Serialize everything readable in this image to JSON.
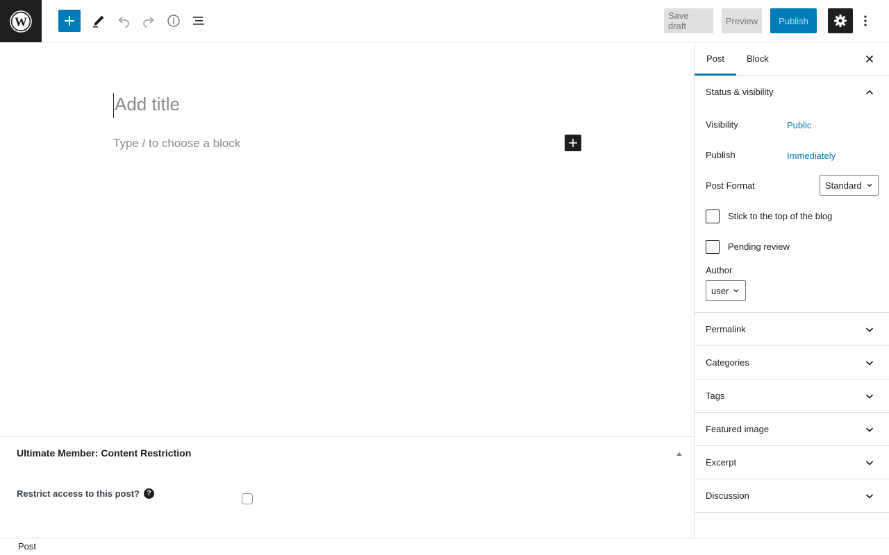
{
  "toolbar": {
    "save_draft": "Save draft",
    "preview": "Preview",
    "publish": "Publish"
  },
  "editor": {
    "title_placeholder": "Add title",
    "block_placeholder": "Type / to choose a block"
  },
  "metabox": {
    "title": "Ultimate Member: Content Restriction",
    "restrict_label": "Restrict access to this post?",
    "help": "?"
  },
  "footer": {
    "breadcrumb": "Post"
  },
  "sidebar": {
    "tabs": [
      {
        "label": "Post",
        "active": true
      },
      {
        "label": "Block",
        "active": false
      }
    ],
    "status": {
      "title": "Status & visibility",
      "visibility_label": "Visibility",
      "visibility_value": "Public",
      "publish_label": "Publish",
      "publish_value": "Immediately",
      "format_label": "Post Format",
      "format_value": "Standard",
      "sticky_label": "Stick to the top of the blog",
      "sticky_checked": false,
      "pending_label": "Pending review",
      "pending_checked": false,
      "author_label": "Author",
      "author_value": "user"
    },
    "panels": [
      {
        "label": "Permalink"
      },
      {
        "label": "Categories"
      },
      {
        "label": "Tags"
      },
      {
        "label": "Featured image"
      },
      {
        "label": "Excerpt"
      },
      {
        "label": "Discussion"
      }
    ]
  },
  "colors": {
    "accent": "#007cba",
    "dark": "#1e1e1e",
    "border": "#e0e0e0",
    "placeholder": "#8a8a8a"
  }
}
